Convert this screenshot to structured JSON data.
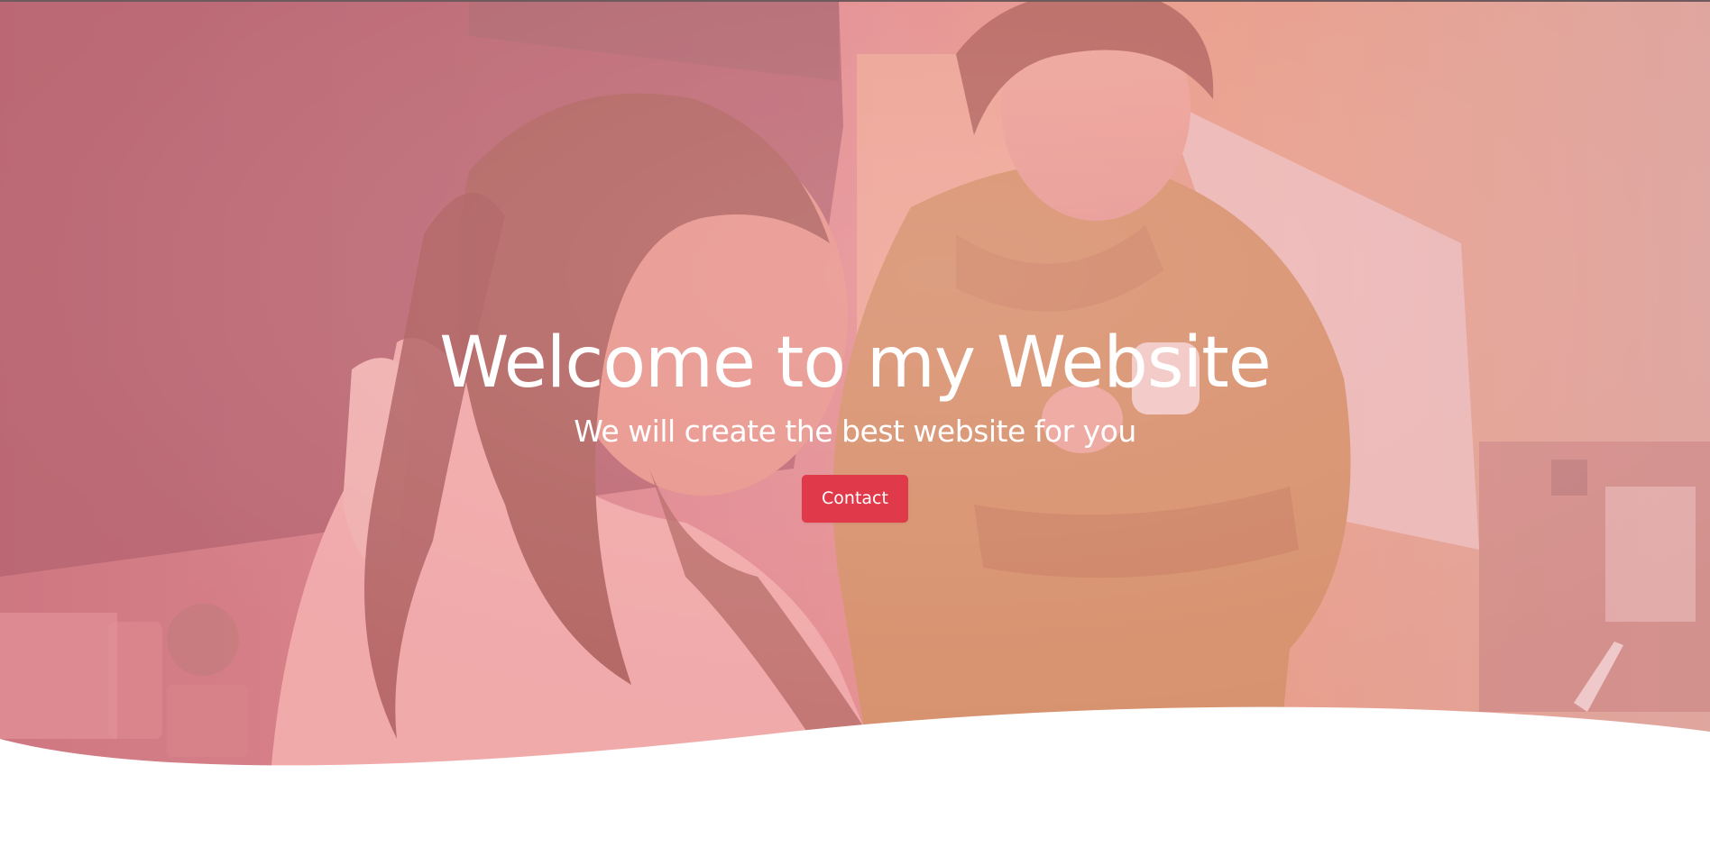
{
  "hero": {
    "title": "Welcome to my Website",
    "subtitle": "We will create the best website for you",
    "contact_label": "Contact",
    "image": "photo-two-women-looking-at-laptop",
    "overlay_color": "#e8707a"
  },
  "colors": {
    "button": "#e0394a",
    "text": "#ffffff",
    "background": "#ffffff"
  }
}
